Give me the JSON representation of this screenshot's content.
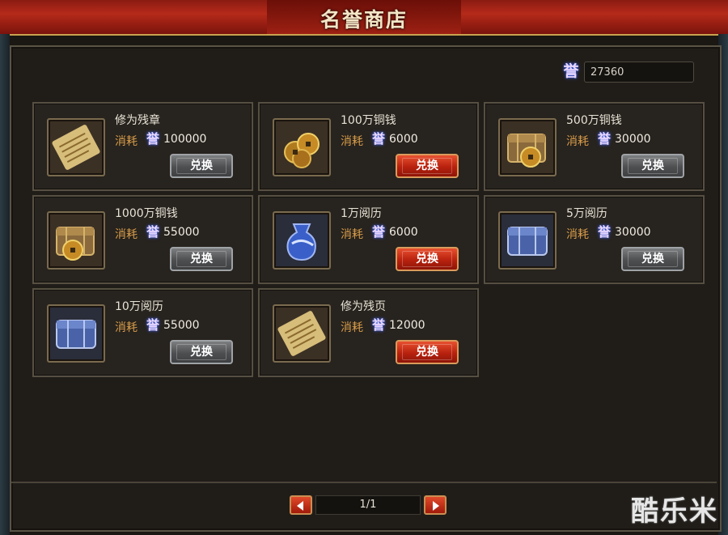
{
  "window": {
    "title": "名誉商店"
  },
  "balance": {
    "icon": "honor-icon",
    "icon_glyph": "誉",
    "value": "27360"
  },
  "cost_label": "消耗",
  "items": [
    {
      "name": "修为残章",
      "cost": "100000",
      "button": "兑换",
      "button_style": "gray",
      "icon": "scroll-icon"
    },
    {
      "name": "100万铜钱",
      "cost": "6000",
      "button": "兑换",
      "button_style": "red",
      "icon": "coins-icon"
    },
    {
      "name": "500万铜钱",
      "cost": "30000",
      "button": "兑换",
      "button_style": "gray",
      "icon": "coin-chest-icon"
    },
    {
      "name": "1000万铜钱",
      "cost": "55000",
      "button": "兑换",
      "button_style": "gray",
      "icon": "coin-chest-icon"
    },
    {
      "name": "1万阅历",
      "cost": "6000",
      "button": "兑换",
      "button_style": "red",
      "icon": "blue-bag-icon"
    },
    {
      "name": "5万阅历",
      "cost": "30000",
      "button": "兑换",
      "button_style": "gray",
      "icon": "blue-chest-icon"
    },
    {
      "name": "10万阅历",
      "cost": "55000",
      "button": "兑换",
      "button_style": "gray",
      "icon": "blue-chest-icon"
    },
    {
      "name": "修为残页",
      "cost": "12000",
      "button": "兑换",
      "button_style": "red",
      "icon": "scroll-icon"
    }
  ],
  "pager": {
    "text": "1/1",
    "current": 1,
    "total": 1
  },
  "watermark": "酷乐米",
  "colors": {
    "title_bar": "#b52a1a",
    "panel_bg": "#201d19",
    "cost_label": "#d89c4a",
    "red_button": "#b8210e",
    "gray_button": "#4d4f51"
  }
}
